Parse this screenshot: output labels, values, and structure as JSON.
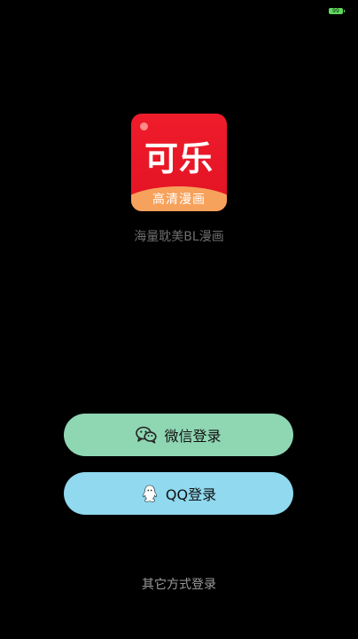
{
  "status_bar": {
    "battery_level": "99",
    "battery_color": "#5fd85f"
  },
  "app": {
    "logo_title": "可乐",
    "logo_subtitle": "高清漫画",
    "tagline": "海量耽美BL漫画",
    "colors": {
      "logo_red": "#e21324",
      "logo_orange": "#f7a25c"
    }
  },
  "login": {
    "wechat": {
      "label": "微信登录",
      "icon": "wechat-icon",
      "color": "#8fd6b3"
    },
    "qq": {
      "label": "QQ登录",
      "icon": "qq-icon",
      "color": "#90d9ef"
    },
    "other_label": "其它方式登录"
  }
}
